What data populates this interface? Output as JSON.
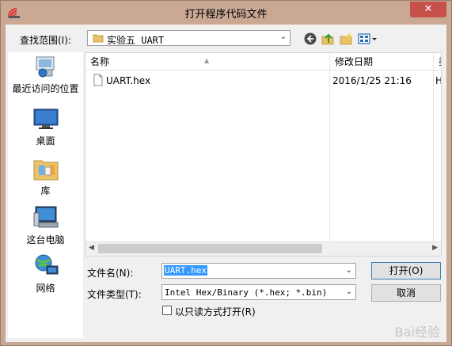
{
  "window": {
    "title": "打开程序代码文件",
    "close_glyph": "✕"
  },
  "toolbar": {
    "look_in_label": "查找范围(I):",
    "look_in_value": "实验五 UART"
  },
  "places": [
    {
      "label": "最近访问的位置",
      "icon": "recent-places-icon"
    },
    {
      "label": "桌面",
      "icon": "desktop-icon"
    },
    {
      "label": "库",
      "icon": "libraries-icon"
    },
    {
      "label": "这台电脑",
      "icon": "computer-icon"
    },
    {
      "label": "网络",
      "icon": "network-icon"
    }
  ],
  "file_list": {
    "columns": [
      "名称",
      "修改日期",
      "类"
    ],
    "rows": [
      {
        "name": "UART.hex",
        "modified": "2016/1/25 21:16",
        "type": "H"
      }
    ]
  },
  "form": {
    "filename_label": "文件名(N):",
    "filename_value": "UART.hex",
    "filetype_label": "文件类型(T):",
    "filetype_value": "Intel Hex/Binary (*.hex; *.bin)",
    "readonly_label": "以只读方式打开(R)",
    "open_button": "打开(O)",
    "cancel_button": "取消"
  },
  "watermark": "Bai经验",
  "colors": {
    "frame": "#caa894",
    "close": "#c7504a",
    "selection": "#3399ff"
  }
}
